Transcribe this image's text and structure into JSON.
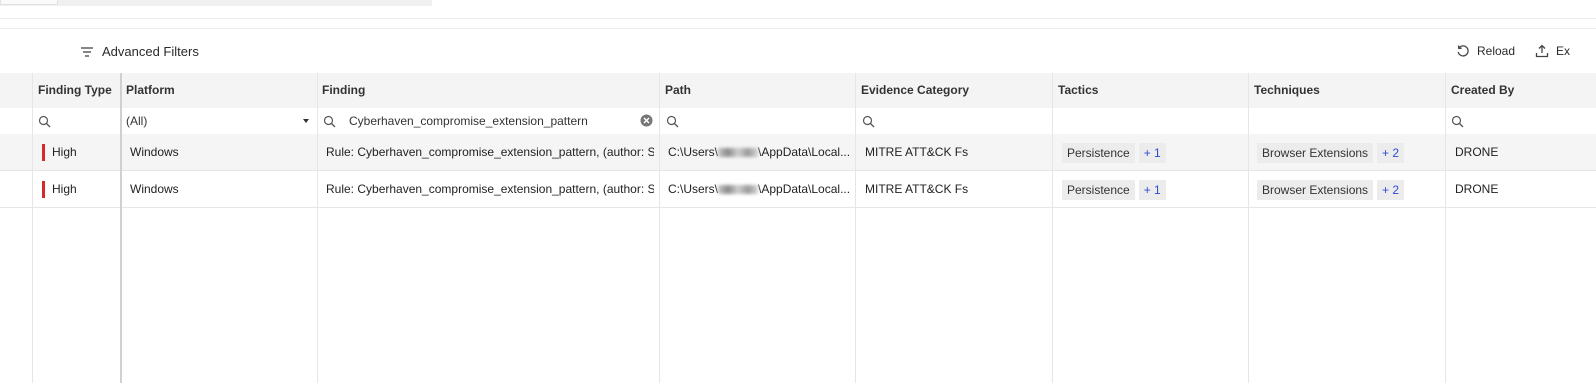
{
  "toolbar": {
    "advanced_filters_label": "Advanced Filters",
    "reload_label": "Reload",
    "export_label": "Ex"
  },
  "columns": [
    {
      "label": "Finding Type"
    },
    {
      "label": "Platform"
    },
    {
      "label": "Finding"
    },
    {
      "label": "Path"
    },
    {
      "label": "Evidence Category"
    },
    {
      "label": "Tactics"
    },
    {
      "label": "Techniques"
    },
    {
      "label": "Created By"
    }
  ],
  "filters": {
    "platform_value": "(All)",
    "finding_value": "Cyberhaven_compromise_extension_pattern"
  },
  "rows": [
    {
      "finding_type": "High",
      "platform": "Windows",
      "finding": "Rule: Cyberhaven_compromise_extension_pattern, (author: S...",
      "path_prefix": "C:\\Users\\",
      "path_suffix": "\\AppData\\Local...",
      "evidence_category": "MITRE ATT&CK Fs",
      "tactic": "Persistence",
      "tactic_more": "+ 1",
      "technique": "Browser Extensions",
      "technique_more": "+ 2",
      "created_by": "DRONE"
    },
    {
      "finding_type": "High",
      "platform": "Windows",
      "finding": "Rule: Cyberhaven_compromise_extension_pattern, (author: S...",
      "path_prefix": "C:\\Users\\",
      "path_suffix": "\\AppData\\Local...",
      "evidence_category": "MITRE ATT&CK Fs",
      "tactic": "Persistence",
      "tactic_more": "+ 1",
      "technique": "Browser Extensions",
      "technique_more": "+ 2",
      "created_by": "DRONE"
    }
  ],
  "colors": {
    "severity_high": "#d12b2b",
    "link_blue": "#2d4bd6",
    "header_bg": "#f4f4f4"
  },
  "icons": {
    "filter": "filter-lines-icon",
    "reload": "reload-icon",
    "export": "upload-icon",
    "search": "search-icon",
    "clear": "clear-circle-icon",
    "dropdown": "caret-down-icon"
  }
}
